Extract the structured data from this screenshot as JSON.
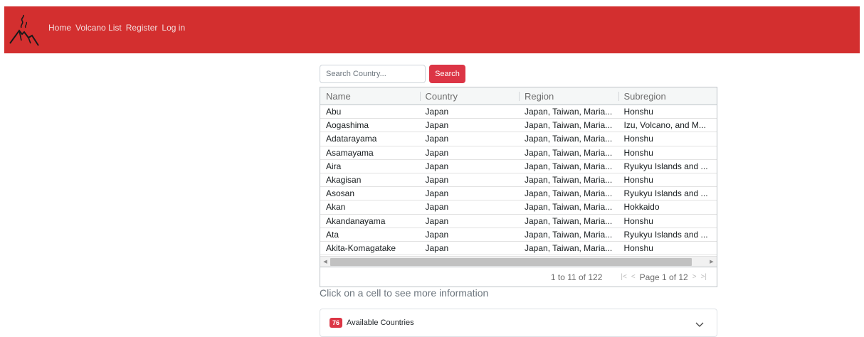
{
  "nav": {
    "items": [
      "Home",
      "Volcano List",
      "Register",
      "Log in"
    ]
  },
  "search": {
    "placeholder": "Search Country...",
    "button_label": "Search"
  },
  "grid": {
    "columns": [
      "Name",
      "Country",
      "Region",
      "Subregion"
    ],
    "rows": [
      [
        "Abu",
        "Japan",
        "Japan, Taiwan, Maria...",
        "Honshu"
      ],
      [
        "Aogashima",
        "Japan",
        "Japan, Taiwan, Maria...",
        "Izu, Volcano, and M..."
      ],
      [
        "Adatarayama",
        "Japan",
        "Japan, Taiwan, Maria...",
        "Honshu"
      ],
      [
        "Asamayama",
        "Japan",
        "Japan, Taiwan, Maria...",
        "Honshu"
      ],
      [
        "Aira",
        "Japan",
        "Japan, Taiwan, Maria...",
        "Ryukyu Islands and ..."
      ],
      [
        "Akagisan",
        "Japan",
        "Japan, Taiwan, Maria...",
        "Honshu"
      ],
      [
        "Asosan",
        "Japan",
        "Japan, Taiwan, Maria...",
        "Ryukyu Islands and ..."
      ],
      [
        "Akan",
        "Japan",
        "Japan, Taiwan, Maria...",
        "Hokkaido"
      ],
      [
        "Akandanayama",
        "Japan",
        "Japan, Taiwan, Maria...",
        "Honshu"
      ],
      [
        "Ata",
        "Japan",
        "Japan, Taiwan, Maria...",
        "Ryukyu Islands and ..."
      ],
      [
        "Akita-Komagatake",
        "Japan",
        "Japan, Taiwan, Maria...",
        "Honshu"
      ]
    ],
    "paging": {
      "summary": "1 to 11 of 122",
      "page_text": "Page 1 of 12",
      "first": "|<",
      "prev": "<",
      "next": ">",
      "last": ">|"
    }
  },
  "hint": "Click on a cell to see more information",
  "accordion": {
    "badge": "76",
    "label": "Available Countries"
  },
  "colors": {
    "topbar": "#d32f2f",
    "accent": "#dc3545"
  }
}
